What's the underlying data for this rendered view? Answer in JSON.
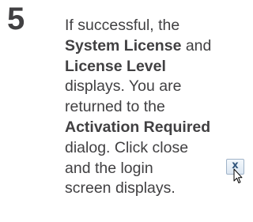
{
  "step": {
    "number": "5",
    "lines": [
      {
        "parts": [
          {
            "text": "If successful, the",
            "bold": false
          }
        ]
      },
      {
        "parts": [
          {
            "text": "System License",
            "bold": true
          },
          {
            "text": " and",
            "bold": false
          }
        ]
      },
      {
        "parts": [
          {
            "text": "License Level",
            "bold": true
          }
        ]
      },
      {
        "parts": [
          {
            "text": "displays. You are",
            "bold": false
          }
        ]
      },
      {
        "parts": [
          {
            "text": "returned to the",
            "bold": false
          }
        ]
      },
      {
        "parts": [
          {
            "text": "Activation Required",
            "bold": true
          }
        ]
      },
      {
        "parts": [
          {
            "text": "dialog. Click close",
            "bold": false
          }
        ]
      },
      {
        "parts": [
          {
            "text": "and the login",
            "bold": false
          }
        ]
      },
      {
        "parts": [
          {
            "text": "screen displays.",
            "bold": false
          }
        ]
      }
    ]
  },
  "close_button": {
    "glyph": "x",
    "icon": "close-icon",
    "cursor_icon": "mouse-pointer-icon"
  },
  "colors": {
    "text": "#414042",
    "close_glyph": "#34577d"
  }
}
